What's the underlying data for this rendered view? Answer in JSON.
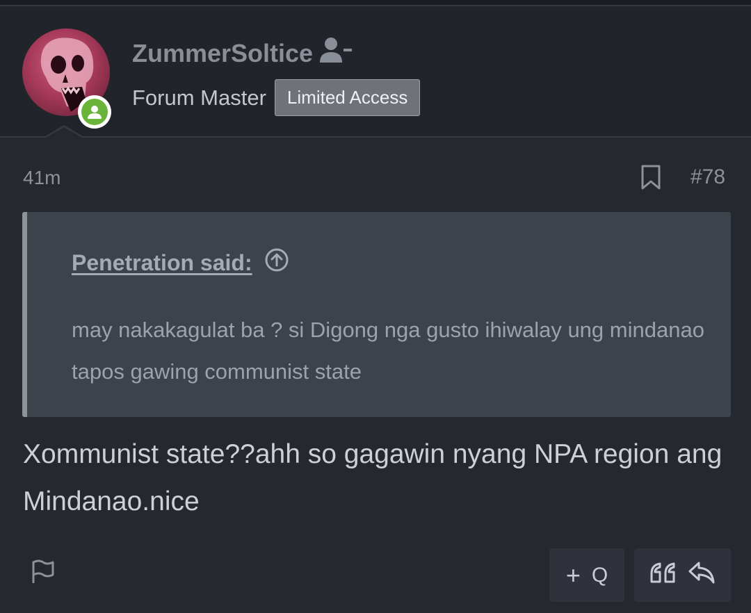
{
  "post": {
    "author": {
      "username": "ZummerSoltice",
      "user_title": "Forum Master",
      "badge": "Limited Access",
      "online": true
    },
    "time_ago": "41m",
    "post_number": "#78",
    "quote": {
      "attribution": "Penetration said:",
      "text": "may nakakagulat ba ? si Digong nga gusto ihiwalay ung mindanao tapos gawing communist state"
    },
    "message": "Xommunist state??ahh so gagawin nyang NPA region ang Mindanao.nice",
    "actions": {
      "multiquote_plus": "+",
      "multiquote_label": "Q"
    }
  },
  "colors": {
    "background": "#262830",
    "header": "#22242b",
    "quote_bg": "#3d434b",
    "online_green": "#6bb43a",
    "avatar_pink": "#a83a5b"
  },
  "icons": [
    "user-unfollow-icon",
    "online-status-icon",
    "bookmark-icon",
    "arrow-up-circle-icon",
    "report-flag-icon",
    "quote-icon",
    "reply-icon"
  ]
}
